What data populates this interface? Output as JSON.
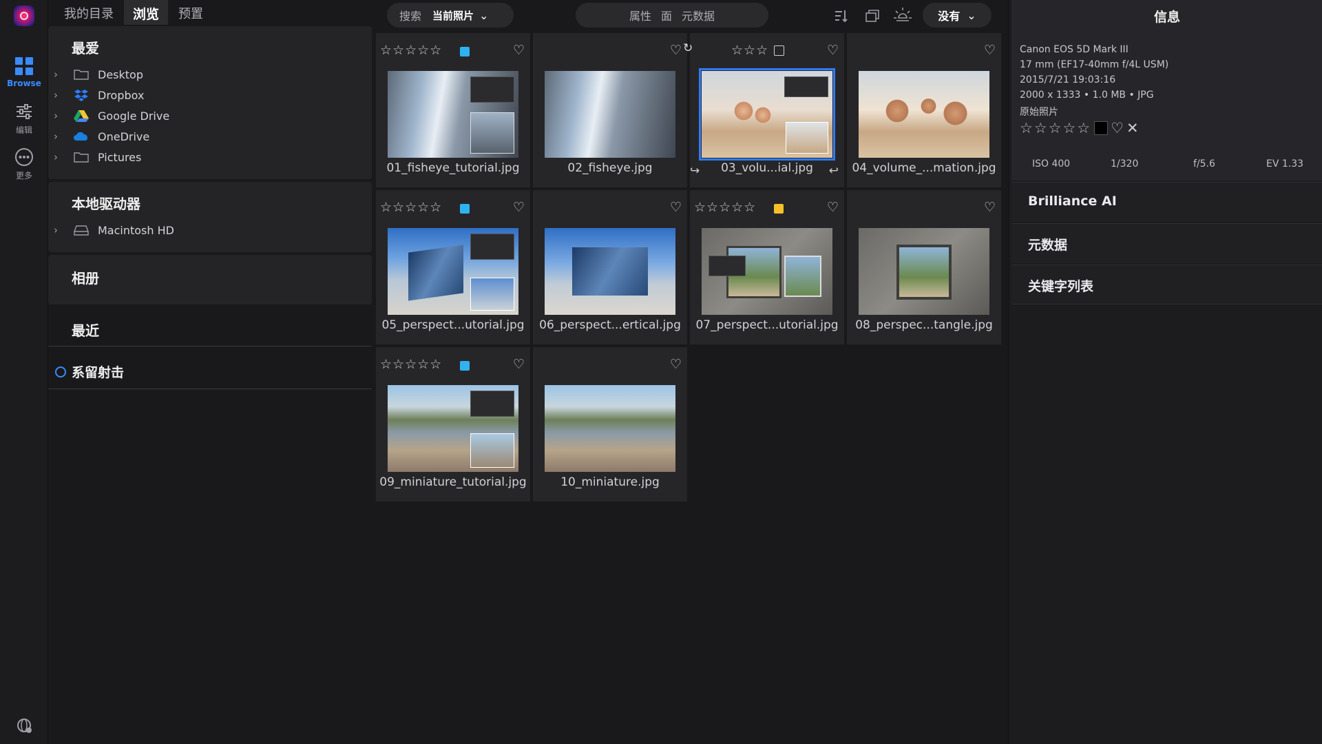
{
  "rail": {
    "browse_label": "Browse",
    "edit_label": "编辑",
    "more_label": "更多",
    "accent": "#3a8bff"
  },
  "tabs": [
    "我的目录",
    "浏览",
    "预置"
  ],
  "sidebar": {
    "favorites_title": "最爱",
    "favorites": [
      {
        "label": "Desktop",
        "icon": "folder-icon"
      },
      {
        "label": "Dropbox",
        "icon": "dropbox-icon"
      },
      {
        "label": "Google Drive",
        "icon": "google-drive-icon"
      },
      {
        "label": "OneDrive",
        "icon": "onedrive-icon"
      },
      {
        "label": "Pictures",
        "icon": "folder-icon"
      }
    ],
    "local_title": "本地驱动器",
    "local": [
      {
        "label": "Macintosh HD",
        "icon": "hard-drive-icon"
      }
    ],
    "albums_title": "相册",
    "recent_title": "最近",
    "tethered_label": "系留射击"
  },
  "toolbar": {
    "search_label": "搜索",
    "search_scope": "当前照片",
    "view_mode_1": "属性",
    "view_mode_2": "面",
    "view_mode_3": "元数据",
    "filter_label": "没有"
  },
  "grid": {
    "items": [
      {
        "name": "01_fisheye_tutorial.jpg",
        "stars": "☆☆☆☆☆",
        "color": "#2fb3f0",
        "heart": "♡"
      },
      {
        "name": "02_fisheye.jpg",
        "stars": "",
        "color": "",
        "heart": "♡"
      },
      {
        "name": "03_volu...ial.jpg",
        "stars": "☆☆☆",
        "color": "",
        "heart": "♡",
        "selected": true
      },
      {
        "name": "04_volume_...mation.jpg",
        "stars": "",
        "color": "",
        "heart": "♡"
      },
      {
        "name": "05_perspect...utorial.jpg",
        "stars": "☆☆☆☆☆",
        "color": "#2fb3f0",
        "heart": "♡"
      },
      {
        "name": "06_perspect...ertical.jpg",
        "stars": "",
        "color": "",
        "heart": "♡"
      },
      {
        "name": "07_perspect...utorial.jpg",
        "stars": "☆☆☆☆☆",
        "color": "#f5c02a",
        "heart": "♡"
      },
      {
        "name": "08_perspec...tangle.jpg",
        "stars": "",
        "color": "",
        "heart": "♡"
      },
      {
        "name": "09_miniature_tutorial.jpg",
        "stars": "☆☆☆☆☆",
        "color": "#2fb3f0",
        "heart": "♡"
      },
      {
        "name": "10_miniature.jpg",
        "stars": "",
        "color": "",
        "heart": "♡"
      }
    ]
  },
  "info": {
    "title": "信息",
    "camera": "Canon EOS 5D Mark III",
    "lens": "17 mm (EF17-40mm f/4L USM)",
    "datetime": "2015/7/21  19:03:16",
    "dims": "2000 x 1333  •  1.0 MB  •  JPG",
    "type": "原始照片",
    "stars": "☆☆☆☆☆",
    "iso": "ISO 400",
    "shutter": "1/320",
    "aperture": "f/5.6",
    "ev": "EV 1.33"
  },
  "sections": [
    "Brilliance AI",
    "元数据",
    "关键字列表"
  ]
}
